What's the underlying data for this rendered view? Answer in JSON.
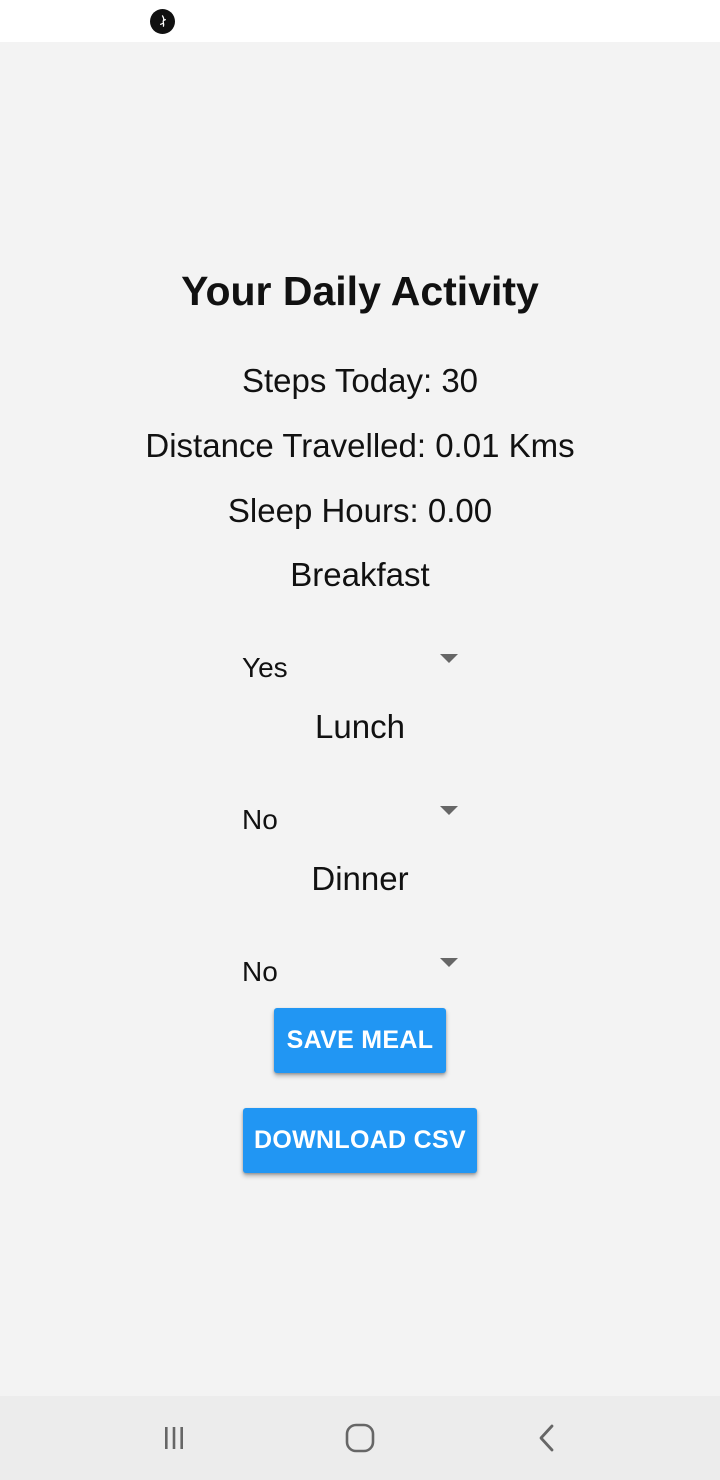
{
  "status_bar": {
    "icon": "app-notification-icon"
  },
  "activity": {
    "title": "Your Daily Activity",
    "steps_text": "Steps Today: 30",
    "distance_text": "Distance Travelled: 0.01 Kms",
    "sleep_text": "Sleep Hours: 0.00"
  },
  "meals": {
    "breakfast_label": "Breakfast",
    "breakfast_value": "Yes",
    "lunch_label": "Lunch",
    "lunch_value": "No",
    "dinner_label": "Dinner",
    "dinner_value": "No"
  },
  "buttons": {
    "save_meal": "SAVE MEAL",
    "download_csv": "DOWNLOAD CSV"
  },
  "nav": {
    "recents_icon": "recents-icon",
    "home_icon": "home-icon",
    "back_icon": "back-icon"
  },
  "colors": {
    "accent": "#2196f3",
    "background": "#f3f3f3"
  }
}
